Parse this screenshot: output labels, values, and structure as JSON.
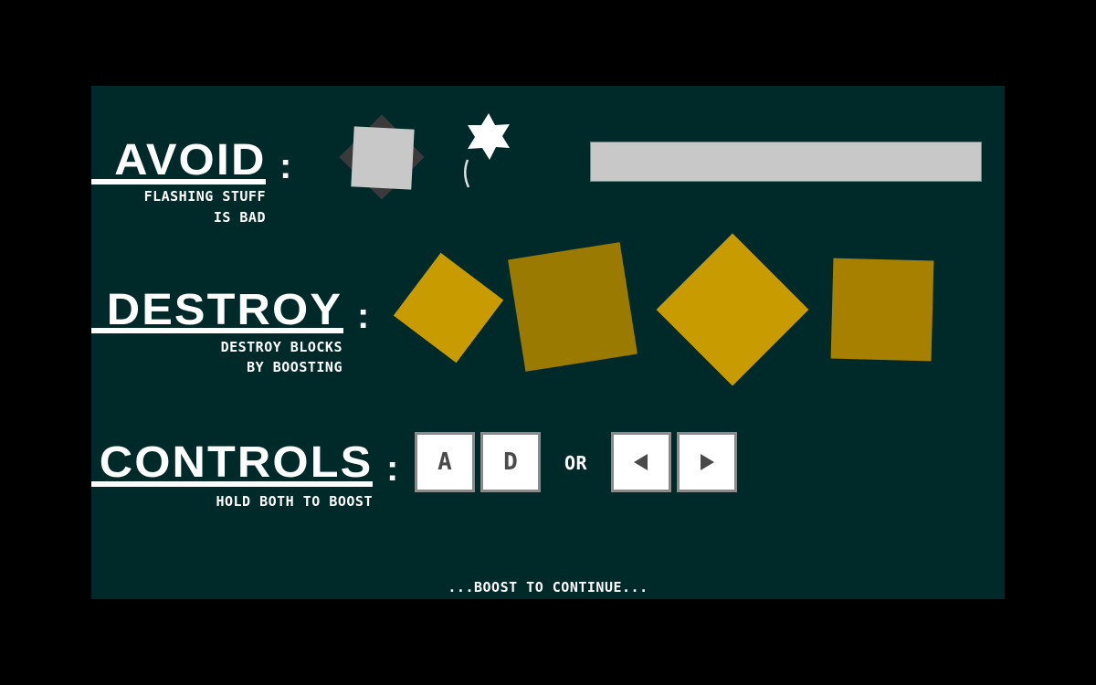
{
  "sections": {
    "avoid": {
      "title": "AVOID",
      "colon": ":",
      "subtitle_line1": "FLASHING STUFF",
      "subtitle_line2": "IS BAD"
    },
    "destroy": {
      "title": "DESTROY",
      "colon": ":",
      "subtitle_line1": "DESTROY BLOCKS",
      "subtitle_line2": "BY BOOSTING"
    },
    "controls": {
      "title": "CONTROLS",
      "colon": ":",
      "subtitle_line1": "HOLD BOTH TO BOOST",
      "keys_set1": [
        "A",
        "D"
      ],
      "or_label": "OR",
      "keys_set2": [
        "left-arrow-icon",
        "right-arrow-icon"
      ]
    }
  },
  "footer": {
    "prompt": "...BOOST TO CONTINUE..."
  },
  "colors": {
    "background": "#00292a",
    "letterbox": "#000000",
    "hazard_block": "#c8c8c8",
    "hazard_shadow": "#3a3a3a",
    "destroy_block_light": "#c89b00",
    "destroy_block_dark": "#9a7a00",
    "destroy_block_mid": "#a88000",
    "text": "#ffffff",
    "key_face": "#ffffff",
    "key_border": "#8a8a8a",
    "key_glyph": "#4a4a4a"
  }
}
